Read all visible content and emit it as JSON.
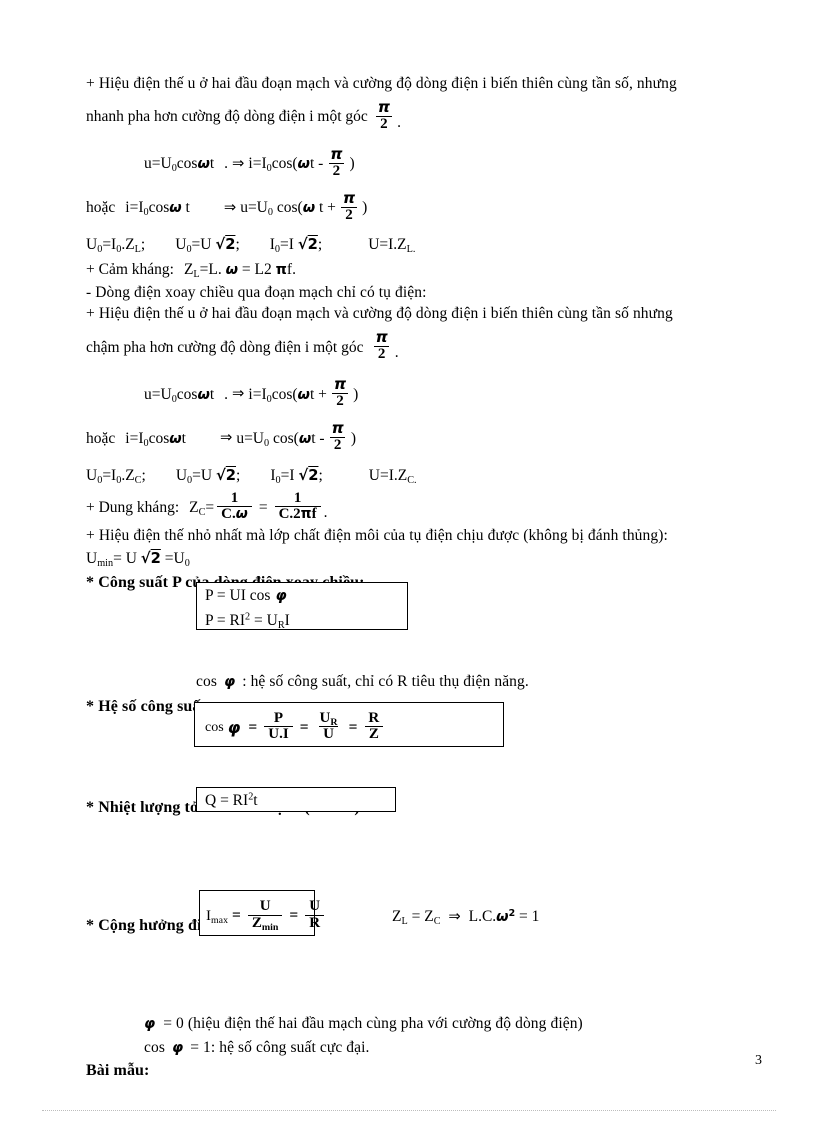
{
  "page": {
    "number": "3",
    "language": "vi"
  },
  "inductor_section": {
    "line1": "+ Hiệu điện thế u ở hai đầu đoạn mạch và  cường độ dòng điện i biến thiên cùng tần số, nhưng",
    "line2_prefix": "nhanh pha hơn cường độ dòng điện i một góc",
    "line2_fraction": {
      "num": "π",
      "den": "2"
    },
    "line2_suffix": ".",
    "eq1": {
      "left": "u=U0cosωt",
      "dot": ".",
      "arrow": "⇒",
      "right_prefix": "i=I0cos(ωt -",
      "fraction": {
        "num": "π",
        "den": "2"
      },
      "right_suffix": ")"
    },
    "eq2": {
      "label": "hoặc",
      "left": "i=I0cosω t",
      "arrow": "⇒",
      "right_prefix": "u=U0 cos(ω t +",
      "fraction": {
        "num": "π",
        "den": "2"
      },
      "right_suffix": ")"
    },
    "relations": {
      "r1": "U0=I0.ZL;",
      "r2_prefix": "U0=U",
      "r2_radical": "√2",
      "r2_suffix": ";",
      "r3_prefix": "I0=I",
      "r3_radical": "√2",
      "r3_suffix": ";",
      "r4": "U=I.ZL."
    },
    "reactance": {
      "label": "+ Cảm kháng:",
      "formula_a": "ZL=L.",
      "omega": "ω",
      "equals": "=",
      "formula_b": "L2",
      "pi": "π",
      "formula_c": "f."
    }
  },
  "capacitor_section": {
    "heading": "- Dòng điện xoay chiều qua đoạn mạch chỉ có tụ điện:",
    "line1": "+ Hiệu điện thế u ở hai đầu đoạn mạch và  cường độ dòng điện i biến thiên cùng tần số nhưng",
    "line2_prefix": "chậm pha hơn cường độ dòng điện i một góc",
    "line2_fraction": {
      "num": "π",
      "den": "2"
    },
    "line2_suffix": ".",
    "eq1": {
      "left": "u=U0cosωt",
      "dot": ".",
      "arrow": "⇒",
      "right_prefix": "i=I0cos(ωt +",
      "fraction": {
        "num": "π",
        "den": "2"
      },
      "right_suffix": ")"
    },
    "eq2": {
      "label": "hoặc",
      "left": "i=I0cosωt",
      "arrow": "⇒",
      "right_prefix": "u=U0 cos(ωt -",
      "fraction": {
        "num": "π",
        "den": "2"
      },
      "right_suffix": ")"
    },
    "relations": {
      "r1": "U0=I0.ZC;",
      "r2_prefix": "U0=U",
      "r2_radical": "√2",
      "r2_suffix": ";",
      "r3_prefix": "I0=I",
      "r3_radical": "√2",
      "r3_suffix": ";",
      "r4": "U=I.ZC."
    },
    "reactance": {
      "label": "+ Dung kháng:",
      "lhs": "ZC=",
      "frac1": {
        "num": "1",
        "den": "C.ω"
      },
      "equals": "=",
      "frac2": {
        "num": "1",
        "den": "C.2πf"
      },
      "period": "."
    },
    "umin": {
      "line": "+ Hiệu điện thế nhỏ nhất mà lớp chất điện môi của tụ điện chịu được (không bị đánh thủng):",
      "formula_prefix": "Umin= U",
      "formula_radical": "√2",
      "formula_suffix": "=U0"
    }
  },
  "power_section": {
    "heading": "* Công suất P của dòng điện xoay chiều:",
    "box": {
      "line1_prefix": "P = UI cos",
      "line1_symbol": "φ",
      "line2": "P = RI2 = URI"
    },
    "note_prefix": "cos",
    "note_symbol": "φ",
    "note_suffix": ": hệ số công suất, chỉ có R tiêu thụ điện năng."
  },
  "power_factor_section": {
    "heading": "* Hệ số công suất:",
    "box": {
      "lhs_prefix": "cos",
      "lhs_symbol": "φ",
      "equals1": "=",
      "frac1": {
        "num": "P",
        "den": "U.I"
      },
      "equals2": "=",
      "frac2": {
        "num": "UR",
        "den": "U"
      },
      "equals3": "=",
      "frac3": {
        "num": "R",
        "den": "Z"
      }
    }
  },
  "heat_section": {
    "heading": "* Nhiệt lượng tỏa ra trên mạch (trên R):",
    "box": {
      "formula": "Q = RI2t"
    }
  },
  "resonance_section": {
    "heading": "* Cộng hưởng  điện:",
    "box": {
      "lhs": "Imax",
      "equals1": "=",
      "frac1": {
        "num": "U",
        "den": "Zmin"
      },
      "equals2": "=",
      "frac2": {
        "num": "U",
        "den": "R"
      }
    },
    "side": {
      "condition": "ZL = ZC",
      "arrow": "⇒",
      "result_prefix": "L.C.",
      "result_symbol": "ω2",
      "result_suffix": "= 1"
    },
    "note1_symbol": "φ",
    "note1_text": "= 0 (hiệu điện thế hai đầu mạch cùng pha với  cường độ dòng điện)",
    "note2_prefix": "cos",
    "note2_symbol": "φ",
    "note2_text": "= 1: hệ số công suất cực đại.",
    "footer_heading": "Bài mẫu:"
  }
}
